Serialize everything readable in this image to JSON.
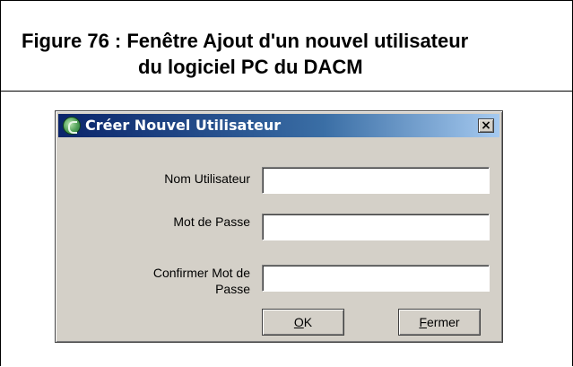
{
  "caption": {
    "line1": "Figure 76 : Fenêtre Ajout d'un nouvel utilisateur",
    "line2": "du logiciel PC du DACM"
  },
  "dialog": {
    "title": "Créer Nouvel Utilisateur",
    "close_glyph": "×",
    "icon": "app-logo-icon",
    "fields": {
      "username_label": "Nom Utilisateur",
      "password_label": "Mot de Passe",
      "confirm_label_line1": "Confirmer Mot de",
      "confirm_label_line2": "Passe",
      "username_value": "",
      "password_value": "",
      "confirm_value": ""
    },
    "buttons": {
      "ok_accel": "O",
      "ok_rest": "K",
      "close_accel": "F",
      "close_rest": "ermer"
    }
  },
  "colors": {
    "titlebar_start": "#0a246a",
    "titlebar_end": "#a6caf0",
    "dialog_bg": "#d4d0c8"
  }
}
